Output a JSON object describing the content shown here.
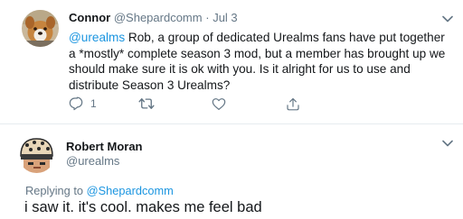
{
  "tweet": {
    "author_name": "Connor",
    "author_handle": "@Shepardcomm",
    "separator": "·",
    "date": "Jul 3",
    "mention": "@urealms",
    "body": " Rob, a group of dedicated Urealms fans have put together a *mostly* complete season 3 mod, but a member has brought up we should make sure it is ok with you. Is it alright for us to use and distribute Season 3 Urealms?",
    "reply_count": "1",
    "icons": [
      "reply-icon",
      "retweet-icon",
      "like-icon",
      "share-icon"
    ]
  },
  "reply": {
    "author_name": "Robert Moran",
    "author_handle": "@urealms",
    "replying_prefix": "Replying to ",
    "replying_to": "@Shepardcomm",
    "body": "i saw it. it's cool. makes me feel bad"
  },
  "colors": {
    "link": "#1b95e0",
    "secondary": "#657786",
    "text": "#14171a",
    "divider": "#e6ecf0"
  }
}
